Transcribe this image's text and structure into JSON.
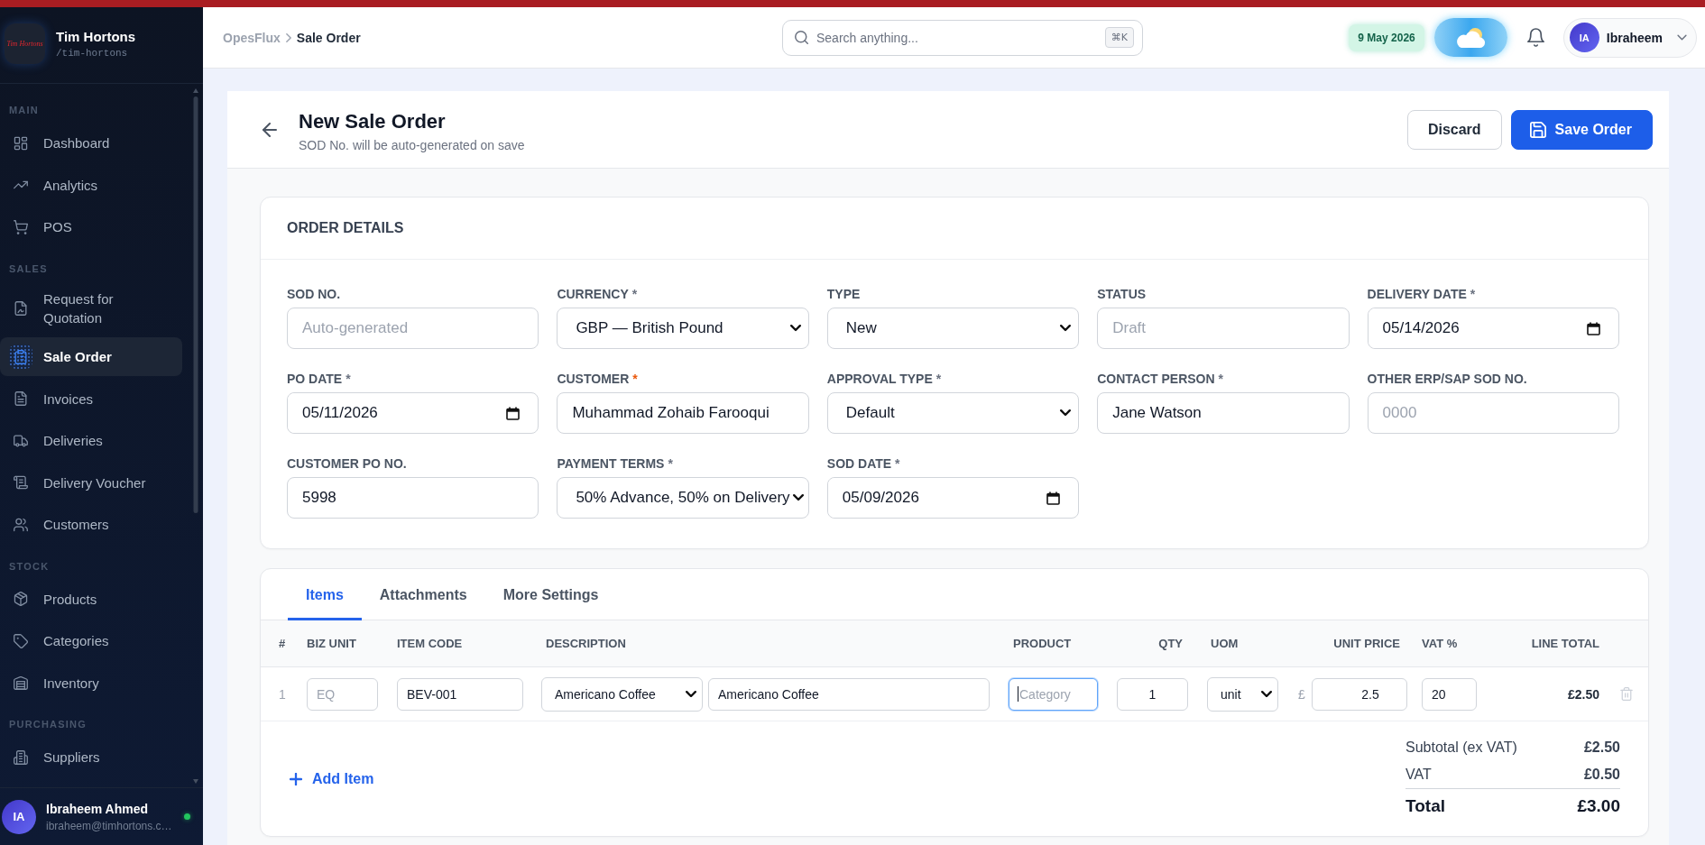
{
  "sidebar": {
    "brand": {
      "logo_text": "Tim Hortons",
      "name": "Tim Hortons",
      "slug": "/tim-hortons"
    },
    "sections": [
      {
        "label": "MAIN",
        "items": [
          {
            "label": "Dashboard",
            "selected": false
          },
          {
            "label": "Analytics",
            "selected": false
          },
          {
            "label": "POS",
            "selected": false
          }
        ]
      },
      {
        "label": "SALES",
        "items": [
          {
            "label": "Request for Quotation",
            "selected": false
          },
          {
            "label": "Sale Order",
            "selected": true
          },
          {
            "label": "Invoices",
            "selected": false
          },
          {
            "label": "Deliveries",
            "selected": false
          },
          {
            "label": "Delivery Voucher",
            "selected": false
          },
          {
            "label": "Customers",
            "selected": false
          }
        ]
      },
      {
        "label": "STOCK",
        "items": [
          {
            "label": "Products",
            "selected": false
          },
          {
            "label": "Categories",
            "selected": false
          },
          {
            "label": "Inventory",
            "selected": false
          }
        ]
      },
      {
        "label": "PURCHASING",
        "items": [
          {
            "label": "Suppliers",
            "selected": false
          }
        ]
      }
    ],
    "user": {
      "initials": "IA",
      "name": "Ibraheem Ahmed",
      "email": "ibraheem@timhortons.c…",
      "online": true
    }
  },
  "top_bar": {
    "breadcrumb": [
      "OpesFlux",
      "Sale Order"
    ],
    "search": {
      "placeholder": "Search anything...",
      "shortcut": "⌘K"
    },
    "date": "9 May 2026",
    "user": {
      "initials": "IA",
      "name": "Ibraheem"
    }
  },
  "page_header": {
    "title": "New Sale Order",
    "subtitle": "SOD No. will be auto-generated on save",
    "actions": [
      {
        "label": "Discard",
        "kind": "secondary"
      },
      {
        "label": "Save Order",
        "kind": "primary"
      }
    ]
  },
  "order_details": {
    "title": "ORDER DETAILS",
    "fields": [
      {
        "label": "SOD NO.",
        "kind": "text",
        "placeholder": "Auto-generated"
      },
      {
        "label": "CURRENCY",
        "required": "*",
        "asterisk_highlighted": false,
        "kind": "select",
        "value": "GBP — British Pound"
      },
      {
        "label": "TYPE",
        "kind": "select",
        "value": "New"
      },
      {
        "label": "STATUS",
        "kind": "text",
        "placeholder": "Draft"
      },
      {
        "label": "DELIVERY DATE",
        "required": "*",
        "asterisk_highlighted": false,
        "kind": "date",
        "value": "05/14/2026"
      },
      {
        "label": "PO DATE",
        "required": "*",
        "asterisk_highlighted": false,
        "kind": "date",
        "value": "05/11/2026"
      },
      {
        "label": "CUSTOMER",
        "required": "*",
        "asterisk_highlighted": true,
        "kind": "text",
        "value": "Muhammad Zohaib Farooqui"
      },
      {
        "label": "APPROVAL TYPE",
        "required": "*",
        "asterisk_highlighted": false,
        "kind": "select",
        "value": "Default"
      },
      {
        "label": "CONTACT PERSON",
        "required": "*",
        "asterisk_highlighted": false,
        "kind": "text",
        "value": "Jane Watson"
      },
      {
        "label": "OTHER ERP/SAP SOD NO.",
        "kind": "text",
        "placeholder": "0000"
      },
      {
        "label": "CUSTOMER PO NO.",
        "kind": "text",
        "value": "5998"
      },
      {
        "label": "PAYMENT TERMS",
        "required": "*",
        "asterisk_highlighted": false,
        "kind": "select",
        "value": "50% Advance, 50% on Delivery"
      },
      {
        "label": "SOD DATE",
        "required": "*",
        "asterisk_highlighted": false,
        "kind": "date",
        "value": "05/09/2026"
      }
    ]
  },
  "items_section": {
    "tabs": [
      {
        "label": "Items",
        "selected": true
      },
      {
        "label": "Attachments",
        "selected": false
      },
      {
        "label": "More Settings",
        "selected": false
      }
    ],
    "columns": [
      "#",
      "BIZ UNIT",
      "ITEM CODE",
      "DESCRIPTION",
      "PRODUCT",
      "QTY",
      "UOM",
      "UNIT PRICE",
      "VAT %",
      "LINE TOTAL"
    ],
    "rows": [
      {
        "number": "1",
        "biz_unit": {
          "placeholder": "EQ"
        },
        "item_code": "BEV-001",
        "description_select": "Americano Coffee",
        "description_text": "Americano Coffee",
        "product": {
          "placeholder": "Category",
          "focused": true
        },
        "qty": "1",
        "uom": "unit",
        "currency": "£",
        "unit_price": "2.5",
        "vat": "20",
        "line_total": "£2.50"
      }
    ],
    "add_item": "Add Item",
    "totals": [
      {
        "label": "Subtotal (ex VAT)",
        "value": "£2.50",
        "kind": "subtotal"
      },
      {
        "label": "VAT",
        "value": "£0.50",
        "kind": "subtotal"
      },
      {
        "label": "Total",
        "value": "£3.00",
        "kind": "grand"
      }
    ]
  }
}
